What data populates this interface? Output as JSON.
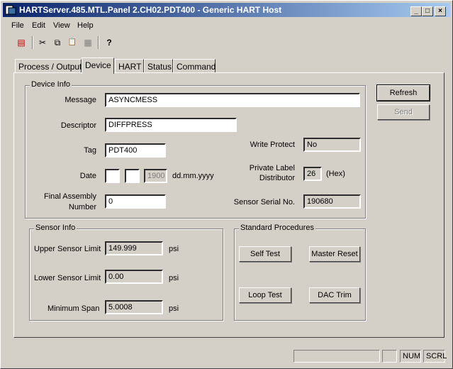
{
  "window": {
    "title": "HARTServer.485.MTL.Panel 2.CH02.PDT400 - Generic HART Host",
    "minimize": "_",
    "maximize": "□",
    "close": "×"
  },
  "menu": [
    "File",
    "Edit",
    "View",
    "Help"
  ],
  "toolbar": {
    "icons": [
      "report-icon",
      "cut-icon",
      "copy-icon",
      "paste-icon",
      "grid-icon",
      "help-icon"
    ],
    "glyphs": [
      "▤",
      "✂",
      "⧉",
      "📋",
      "▦",
      "?"
    ]
  },
  "tabs": [
    "Process / Output",
    "Device",
    "HART",
    "Status",
    "Command"
  ],
  "active_tab": "Device",
  "buttons": {
    "refresh": "Refresh",
    "send": "Send"
  },
  "device_info": {
    "legend": "Device Info",
    "message_label": "Message",
    "message_value": "ASYNCMESS",
    "descriptor_label": "Descriptor",
    "descriptor_value": "DIFFPRESS",
    "tag_label": "Tag",
    "tag_value": "PDT400",
    "date_label": "Date",
    "date_day": "",
    "date_month": "",
    "date_year": "1900",
    "date_format": "dd.mm.yyyy",
    "final_assembly_label_1": "Final Assembly",
    "final_assembly_label_2": "Number",
    "final_assembly_value": "0",
    "write_protect_label": "Write Protect",
    "write_protect_value": "No",
    "distributor_label_1": "Private Label",
    "distributor_label_2": "Distributor",
    "distributor_value": "26",
    "distributor_unit": "(Hex)",
    "serial_label": "Sensor Serial No.",
    "serial_value": "190680"
  },
  "sensor_info": {
    "legend": "Sensor Info",
    "upper_label": "Upper Sensor Limit",
    "upper_value": "149.999",
    "upper_unit": "psi",
    "lower_label": "Lower Sensor Limit",
    "lower_value": "0.00",
    "lower_unit": "psi",
    "span_label": "Minimum Span",
    "span_value": "5.0008",
    "span_unit": "psi"
  },
  "procedures": {
    "legend": "Standard Procedures",
    "self_test": "Self Test",
    "master_reset": "Master Reset",
    "loop_test": "Loop Test",
    "dac_trim": "DAC Trim"
  },
  "status": {
    "num": "NUM",
    "scrl": "SCRL"
  }
}
